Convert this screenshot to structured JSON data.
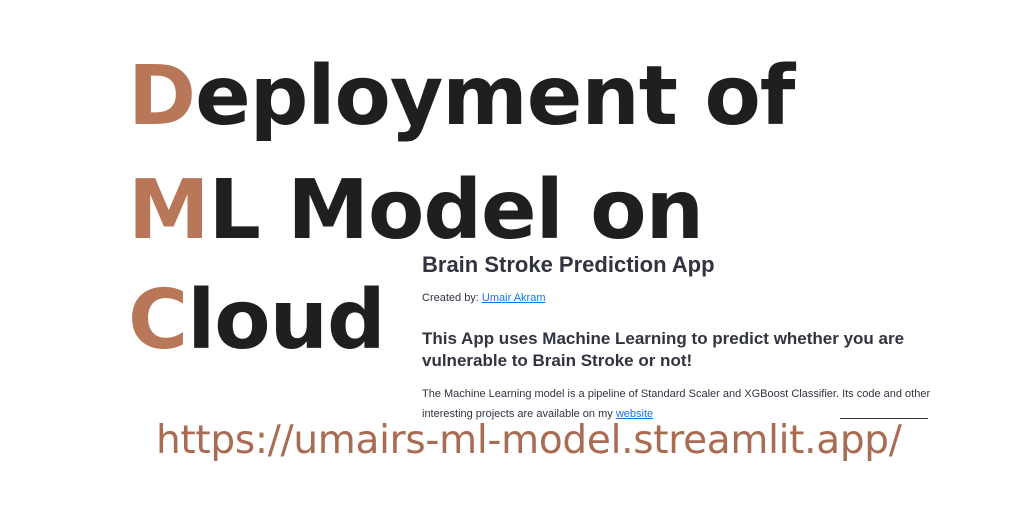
{
  "headline": {
    "line1": {
      "initial": "D",
      "rest": "eployment of"
    },
    "line2": {
      "initial": "M",
      "rest": "L Model on"
    },
    "line3": {
      "initial": "C",
      "rest": "loud"
    }
  },
  "app": {
    "title": "Brain Stroke Prediction App",
    "created_by_label": "Created by: ",
    "author_link": "Umair Akram",
    "subtitle": "This App uses Machine Learning to predict whether you are vulnerable to Brain Stroke or not!",
    "description": "The Machine Learning model is a pipeline of Standard Scaler and XGBoost Classifier. Its code and other interesting projects are available on my ",
    "website_link": "website"
  },
  "url": "https://umairs-ml-model.streamlit.app/",
  "colors": {
    "accent": "#b9775a",
    "url": "#a86c52",
    "headline": "#1f1f1f",
    "link": "#1a73e8"
  }
}
